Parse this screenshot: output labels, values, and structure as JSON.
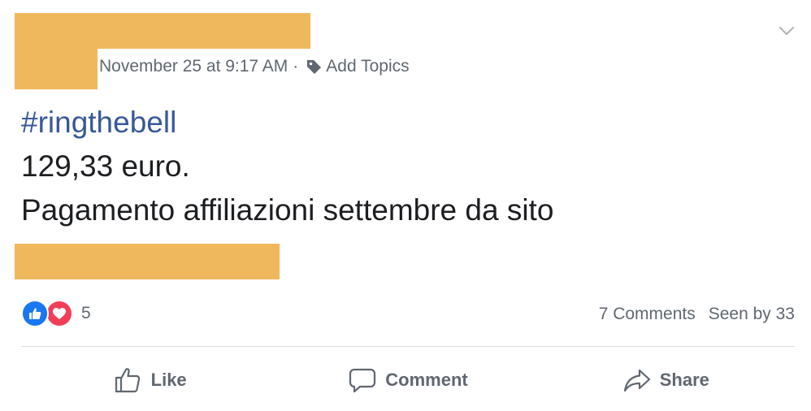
{
  "post": {
    "timestamp": "November 25 at 9:17 AM",
    "separator": "·",
    "add_topics_label": "Add Topics",
    "hashtag": "#ringthebell",
    "body_lines": [
      "129,33 euro.",
      "Pagamento affiliazioni settembre da sito"
    ]
  },
  "reactions": {
    "count": "5",
    "types": [
      "like-icon",
      "love-icon"
    ]
  },
  "stats": {
    "comments": "7 Comments",
    "seen_by": "Seen by 33"
  },
  "actions": {
    "like_label": "Like",
    "comment_label": "Comment",
    "share_label": "Share"
  },
  "icons": {
    "menu": "chevron-down-icon",
    "topic": "tag-icon",
    "like": "thumbs-up-icon",
    "comment": "speech-bubble-icon",
    "share": "share-arrow-icon"
  },
  "colors": {
    "hashtag": "#385898",
    "secondary_text": "#606770",
    "primary_text": "#1c1e21",
    "redaction": "#f0b85c",
    "like_blue": "#1877f2",
    "love_red": "#f33e58",
    "divider": "#dadde1"
  }
}
